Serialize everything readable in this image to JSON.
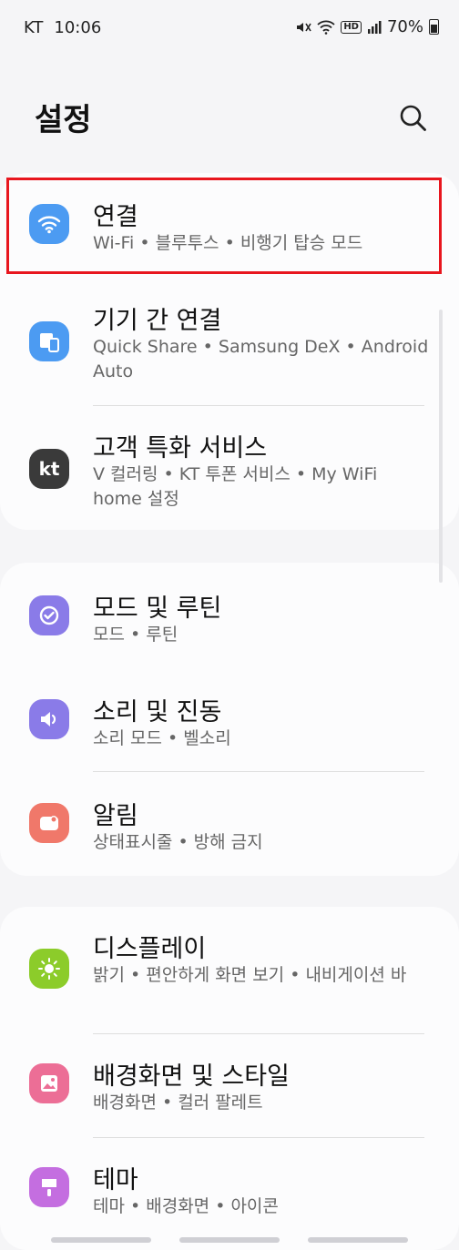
{
  "statusbar": {
    "carrier": "KT",
    "time": "10:06",
    "hd": "HD",
    "battery": "70%"
  },
  "header": {
    "title": "설정"
  },
  "groups": [
    {
      "items": [
        {
          "title": "연결",
          "subtitle": "Wi-Fi • 블루투스 • 비행기 탑승 모드",
          "icon": "wifi-icon",
          "color": "#4c9bf2"
        },
        {
          "title": "기기 간 연결",
          "subtitle": "Quick Share • Samsung DeX • Android Auto",
          "icon": "devices-icon",
          "color": "#4c9bf2"
        },
        {
          "title": "고객 특화 서비스",
          "subtitle": "V 컬러링 • KT 투폰 서비스 • My WiFi home 설정",
          "icon": "kt-logo-icon",
          "color": "#3a3a3a",
          "glyph": "kt"
        }
      ]
    },
    {
      "items": [
        {
          "title": "모드 및 루틴",
          "subtitle": "모드 • 루틴",
          "icon": "routine-check-icon",
          "color": "#8a7be8"
        },
        {
          "title": "소리 및 진동",
          "subtitle": "소리 모드 • 벨소리",
          "icon": "speaker-icon",
          "color": "#8a7be8"
        },
        {
          "title": "알림",
          "subtitle": "상태표시줄 • 방해 금지",
          "icon": "notification-icon",
          "color": "#f0786a"
        }
      ]
    },
    {
      "items": [
        {
          "title": "디스플레이",
          "subtitle": "밝기 • 편안하게 화면 보기 • 내비게이션 바",
          "icon": "brightness-icon",
          "color": "#8ccc2a"
        },
        {
          "title": "배경화면 및 스타일",
          "subtitle": "배경화면 • 컬러 팔레트",
          "icon": "wallpaper-icon",
          "color": "#ec6e96"
        },
        {
          "title": "테마",
          "subtitle": "테마 • 배경화면 • 아이콘",
          "icon": "theme-brush-icon",
          "color": "#c46ee0"
        }
      ]
    }
  ]
}
